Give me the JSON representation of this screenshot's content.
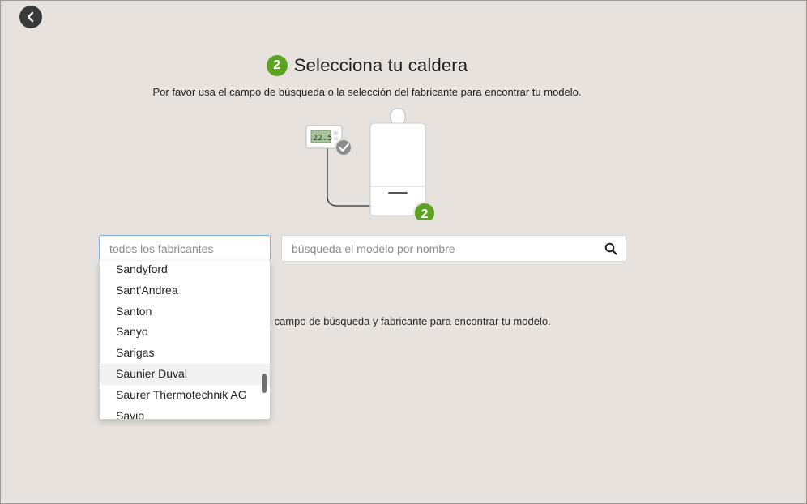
{
  "nav": {
    "back_icon": "chevron-left-icon"
  },
  "header": {
    "step_number": "2",
    "title": "Selecciona tu caldera",
    "subtitle": "Por favor usa el campo de búsqueda o la selección del fabricante para encontrar tu modelo."
  },
  "illustration": {
    "thermostat_display": "22.5",
    "boiler_step_number": "2"
  },
  "manufacturer_select": {
    "placeholder": "todos los fabricantes",
    "value": "",
    "options": [
      "Sandyford",
      "Sant'Andrea",
      "Santon",
      "Sanyo",
      "Sarigas",
      "Saunier Duval",
      "Saurer Thermotechnik AG",
      "Savio"
    ],
    "highlighted": "Saunier Duval"
  },
  "model_search": {
    "placeholder": "búsqueda el modelo por nombre",
    "value": "",
    "icon": "search-icon"
  },
  "hint": "a el campo de búsqueda y fabricante para encontrar tu modelo.",
  "colors": {
    "background": "#e7e2de",
    "accent_green": "#5aa41f",
    "focus_border": "#7fb0dd"
  }
}
